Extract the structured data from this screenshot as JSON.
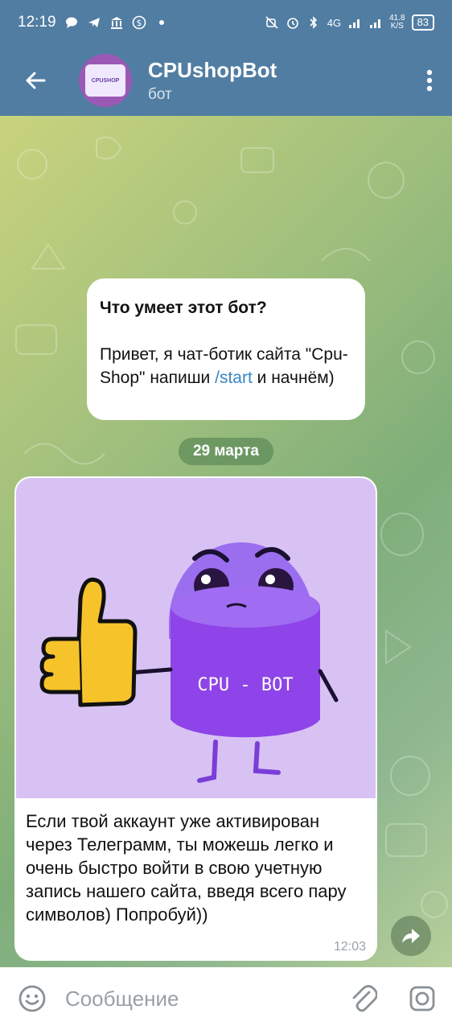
{
  "status_bar": {
    "time": "12:19",
    "network": "4G",
    "speed_value": "41.8",
    "speed_unit": "K/S",
    "battery": "83"
  },
  "header": {
    "title": "CPUshopBot",
    "subtitle": "бот",
    "avatar_text": "CPUSHOP"
  },
  "info_card": {
    "title": "Что умеет этот бот?",
    "body_before": "Привет, я чат-ботик сайта \"Cpu-Shop\" напиши ",
    "command": "/start",
    "body_after": " и начнём)"
  },
  "date_separator": "29 марта",
  "message": {
    "image_label": "CPU - BOT",
    "text": "Если твой аккаунт уже активирован через Телеграмм, ты можешь легко и очень быстро войти в свою учетную запись нашего сайта, введя всего пару символов) Попробуй))",
    "time": "12:03"
  },
  "input": {
    "placeholder": "Сообщение"
  },
  "colors": {
    "header": "#517da2",
    "link": "#3a86c4",
    "image_bg": "#d8c2f4",
    "mascot": "#8e44e8"
  },
  "icons": [
    "back-arrow-icon",
    "more-vertical-icon",
    "share-icon",
    "emoji-icon",
    "attach-icon",
    "camera-icon"
  ]
}
